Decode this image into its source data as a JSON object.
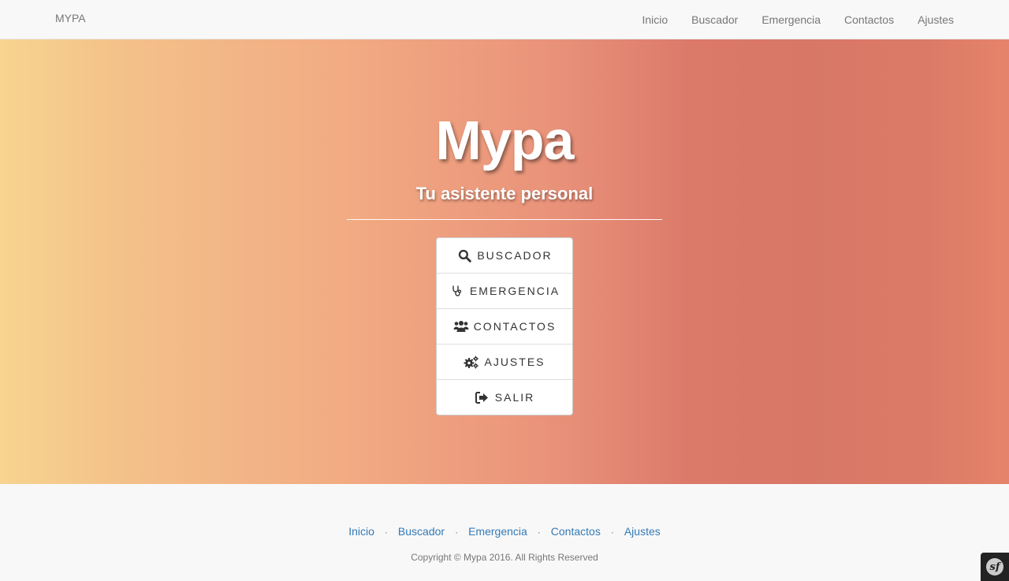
{
  "navbar": {
    "brand": "MYPA",
    "links": [
      "Inicio",
      "Buscador",
      "Emergencia",
      "Contactos",
      "Ajustes"
    ]
  },
  "hero": {
    "title": "Mypa",
    "subtitle": "Tu asistente personal",
    "menu": [
      {
        "label": "BUSCADOR",
        "icon": "search-icon"
      },
      {
        "label": "EMERGENCIA",
        "icon": "stethoscope-icon"
      },
      {
        "label": "CONTACTOS",
        "icon": "users-icon"
      },
      {
        "label": "AJUSTES",
        "icon": "gears-icon"
      },
      {
        "label": "SALIR",
        "icon": "sign-out-icon"
      }
    ]
  },
  "footer": {
    "links": [
      "Inicio",
      "Buscador",
      "Emergencia",
      "Contactos",
      "Ajustes"
    ],
    "separator": "·",
    "copyright": "Copyright © Mypa 2016. All Rights Reserved"
  },
  "debug_toolbar": {
    "icon": "symfony-icon",
    "glyph": "sf"
  },
  "colors": {
    "link": "#337ab7",
    "nav_text": "#777777",
    "gradient_left": "#f7d48f",
    "gradient_right": "#db7b67"
  }
}
